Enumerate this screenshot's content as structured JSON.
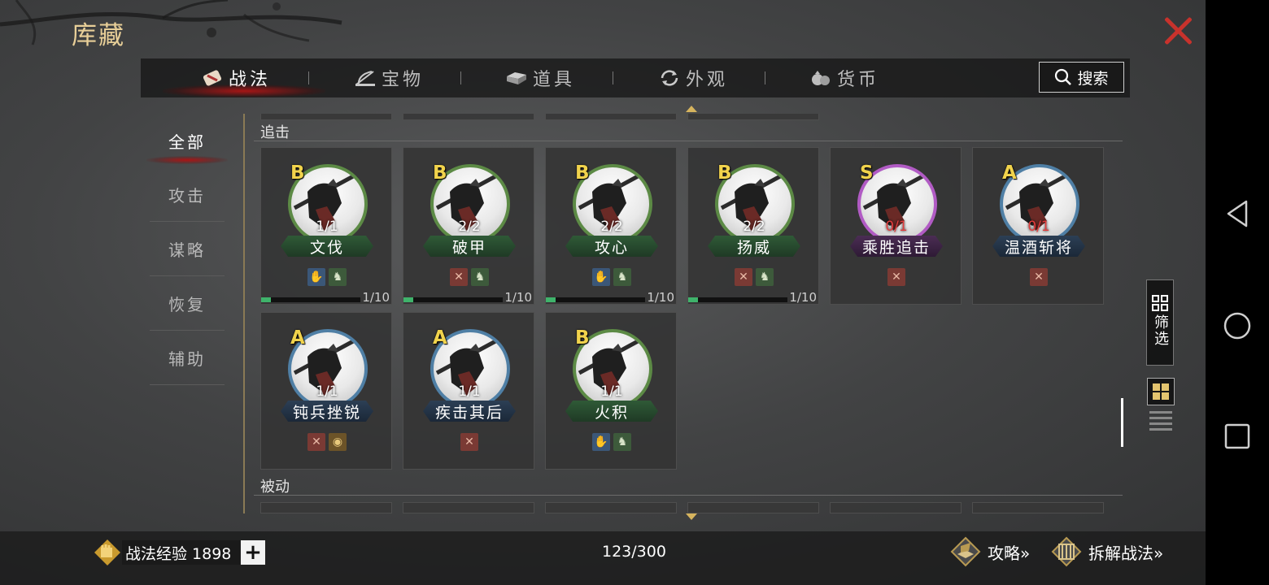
{
  "header": {
    "title": "库藏"
  },
  "tabs": [
    {
      "label": "战法",
      "icon": "scroll-icon"
    },
    {
      "label": "宝物",
      "icon": "bow-icon"
    },
    {
      "label": "道具",
      "icon": "box-icon"
    },
    {
      "label": "外观",
      "icon": "refresh-icon"
    },
    {
      "label": "货币",
      "icon": "money-bag-icon"
    }
  ],
  "search": {
    "label": "搜索"
  },
  "sidebar": {
    "items": [
      {
        "label": "全部",
        "active": true
      },
      {
        "label": "攻击"
      },
      {
        "label": "谋略"
      },
      {
        "label": "恢复"
      },
      {
        "label": "辅助"
      }
    ]
  },
  "sections": {
    "pursuit": "追击",
    "passive": "被动"
  },
  "cards": [
    {
      "grade": "B",
      "level": "1/1",
      "name": "文伐",
      "rarity": "B",
      "tags": [
        "blue",
        "green"
      ],
      "progress": "1/10",
      "progress_value": 0.1
    },
    {
      "grade": "B",
      "level": "2/2",
      "name": "破甲",
      "rarity": "B",
      "tags": [
        "red",
        "green"
      ],
      "progress": "1/10",
      "progress_value": 0.1
    },
    {
      "grade": "B",
      "level": "2/2",
      "name": "攻心",
      "rarity": "B",
      "tags": [
        "blue",
        "green"
      ],
      "progress": "1/10",
      "progress_value": 0.1
    },
    {
      "grade": "B",
      "level": "2/2",
      "name": "扬威",
      "rarity": "B",
      "tags": [
        "red",
        "green"
      ],
      "progress": "1/10",
      "progress_value": 0.1
    },
    {
      "grade": "S",
      "level": "0/1",
      "name": "乘胜追击",
      "rarity": "S",
      "tags": [
        "red"
      ],
      "progress": null
    },
    {
      "grade": "A",
      "level": "0/1",
      "name": "温酒斩将",
      "rarity": "A",
      "tags": [
        "red"
      ],
      "progress": null
    },
    {
      "grade": "A",
      "level": "1/1",
      "name": "钝兵挫锐",
      "rarity": "A",
      "tags": [
        "red",
        "gold"
      ],
      "progress": null
    },
    {
      "grade": "A",
      "level": "1/1",
      "name": "疾击其后",
      "rarity": "A",
      "tags": [
        "red"
      ],
      "progress": null
    },
    {
      "grade": "B",
      "level": "1/1",
      "name": "火积",
      "rarity": "B",
      "tags": [
        "blue",
        "green"
      ],
      "progress": null
    }
  ],
  "filter": {
    "label": "筛选"
  },
  "footer": {
    "exp_label": "战法经验 1898",
    "plus": "+",
    "count": "123/300",
    "guide": "攻略»",
    "decompose": "拆解战法»"
  },
  "colors": {
    "accent_gold": "#e8cf98",
    "grade_yellow": "#f1d34c",
    "rarity_b": "#5c8a45",
    "rarity_a": "#4f7fa5",
    "rarity_s": "#b15bc4",
    "close_red": "#c8322c",
    "progress_green": "#3fb36b"
  }
}
